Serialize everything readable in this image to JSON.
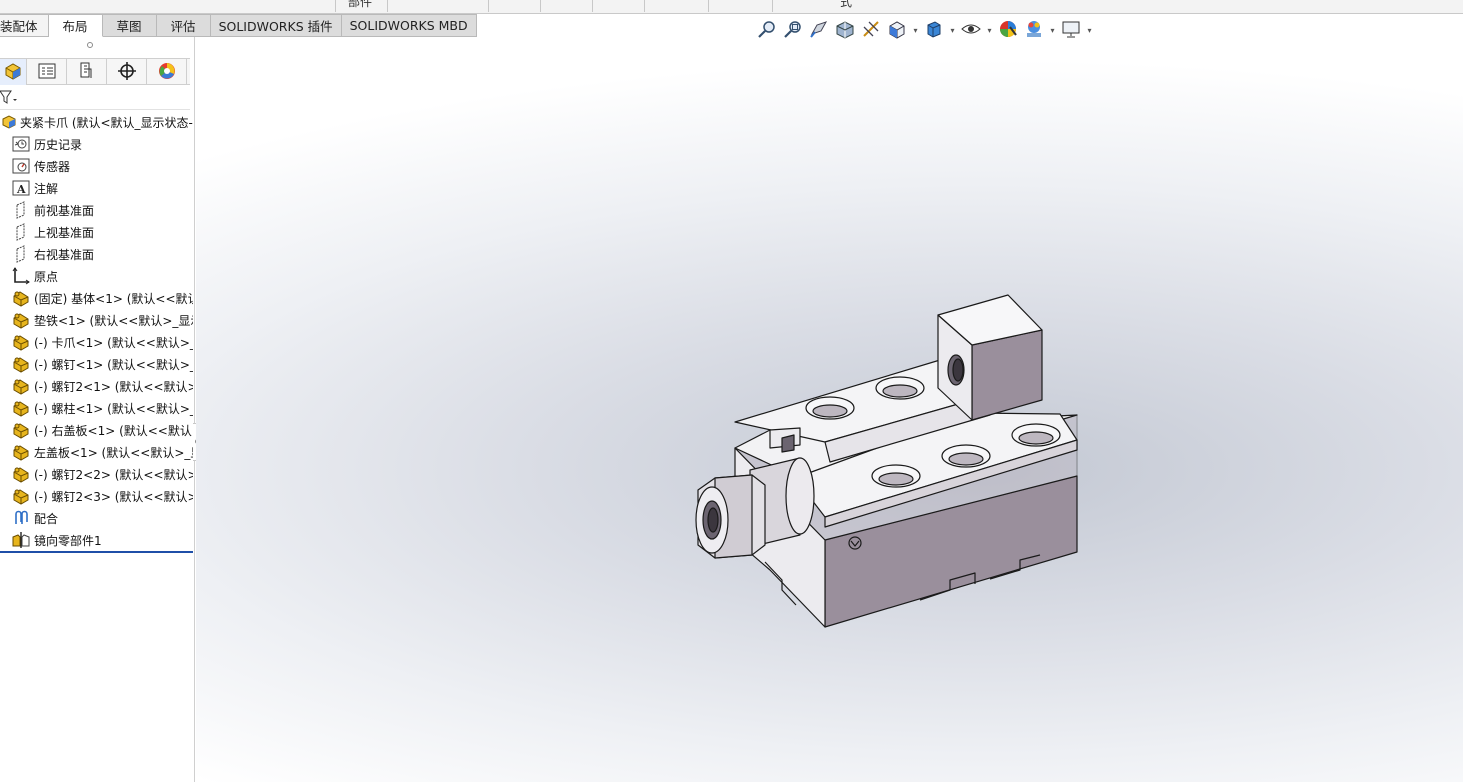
{
  "tabs": {
    "items": [
      {
        "label": "装配体"
      },
      {
        "label": "布局"
      },
      {
        "label": "草图"
      },
      {
        "label": "评估"
      },
      {
        "label": "SOLIDWORKS 插件"
      },
      {
        "label": "SOLIDWORKS MBD"
      }
    ],
    "active_index": 1
  },
  "top_strip": {
    "fragments": [
      "部件",
      "式"
    ]
  },
  "feature_tree": {
    "root": {
      "label": "夹紧卡爪  (默认<默认_显示状态-1"
    },
    "items": [
      {
        "label": "历史记录",
        "icon": "history-icon"
      },
      {
        "label": "传感器",
        "icon": "sensor-icon"
      },
      {
        "label": "注解",
        "icon": "annotation-icon"
      },
      {
        "label": "前视基准面",
        "icon": "plane-icon"
      },
      {
        "label": "上视基准面",
        "icon": "plane-icon"
      },
      {
        "label": "右视基准面",
        "icon": "plane-icon"
      },
      {
        "label": "原点",
        "icon": "origin-icon"
      },
      {
        "label": "(固定) 基体<1> (默认<<默认",
        "icon": "part-icon"
      },
      {
        "label": "垫铁<1> (默认<<默认>_显示",
        "icon": "part-icon"
      },
      {
        "label": "(-) 卡爪<1> (默认<<默认>_显",
        "icon": "part-icon"
      },
      {
        "label": "(-) 螺钉<1> (默认<<默认>_显",
        "icon": "part-icon"
      },
      {
        "label": "(-) 螺钉2<1> (默认<<默认>_",
        "icon": "part-icon"
      },
      {
        "label": "(-) 螺柱<1> (默认<<默认>_显",
        "icon": "part-icon"
      },
      {
        "label": "(-) 右盖板<1> (默认<<默认>",
        "icon": "part-icon"
      },
      {
        "label": "左盖板<1> (默认<<默认>_显示",
        "icon": "part-icon"
      },
      {
        "label": "(-) 螺钉2<2> (默认<<默认>_",
        "icon": "part-icon"
      },
      {
        "label": "(-) 螺钉2<3> (默认<<默认>_",
        "icon": "part-icon"
      },
      {
        "label": "配合",
        "icon": "mate-icon"
      },
      {
        "label": "镜向零部件1",
        "icon": "mirror-component-icon"
      }
    ]
  },
  "colors": {
    "part_icon": "#e7b51d",
    "active_line": "#1f4fa8",
    "model_face_top": "#f4f4f6",
    "model_face_side": "#9a8f9c"
  }
}
